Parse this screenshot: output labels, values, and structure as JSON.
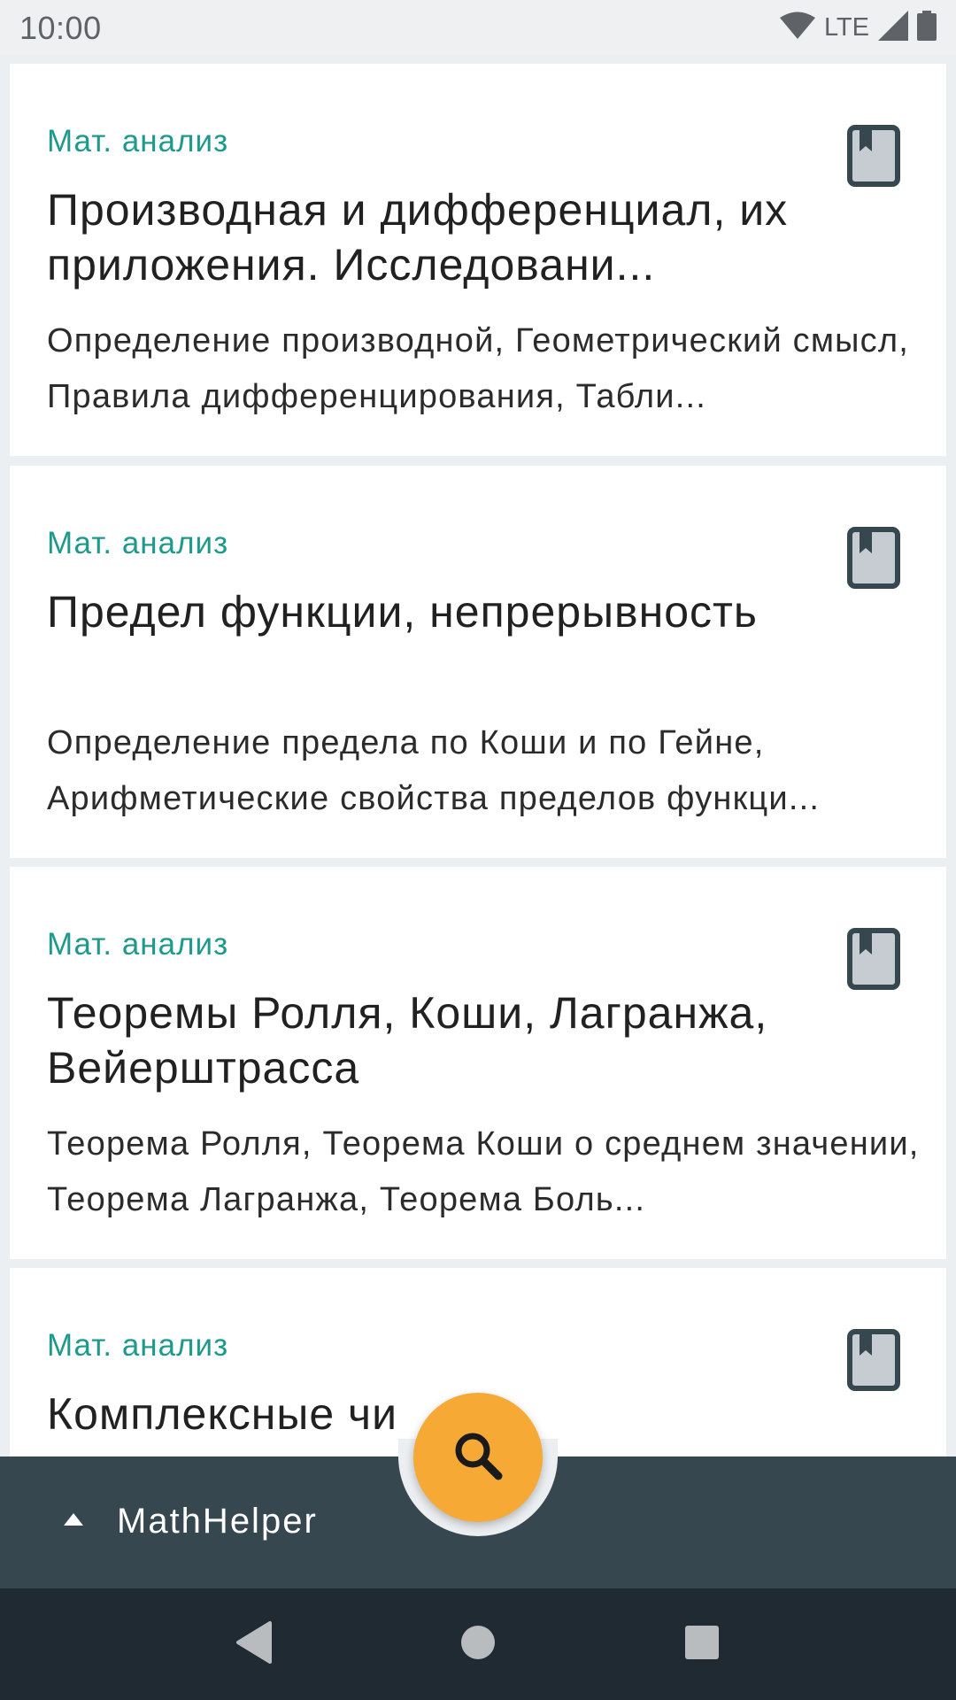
{
  "status_bar": {
    "time": "10:00",
    "network": "LTE"
  },
  "cards": [
    {
      "category": "Мат. анализ",
      "title": "Производная и дифференциал, их приложения. Исследовани...",
      "description": "Определение производной, Геометрический смысл, Правила дифференцирования, Табли..."
    },
    {
      "category": "Мат. анализ",
      "title": "Предел функции, непрерывность",
      "description": "Определение предела по Коши и по Гейне, Арифметические свойства пределов функци..."
    },
    {
      "category": "Мат. анализ",
      "title": "Теоремы Ролля, Коши, Лагранжа, Вейерштрасса",
      "description": "Теорема Ролля, Теорема Коши о среднем значении, Теорема Лагранжа, Теорема Боль..."
    },
    {
      "category": "Мат. анализ",
      "title": "Комплексные чи",
      "description": ""
    }
  ],
  "bottom_bar": {
    "app_title": "MathHelper",
    "fab_icon": "search-icon",
    "expand_icon": "caret-up-icon"
  },
  "colors": {
    "accent": "#1e9a8c",
    "fab": "#f6a935",
    "bottom_bar": "#36474f",
    "nav_bar": "#1f2a33",
    "bookmark": "#36474f"
  }
}
